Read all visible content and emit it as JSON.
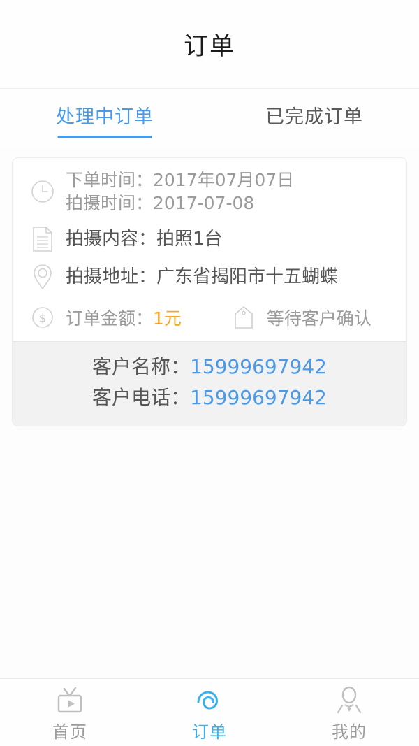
{
  "header": {
    "title": "订单"
  },
  "tabs": [
    {
      "label": "处理中订单",
      "active": true,
      "name": "tab-processing-orders"
    },
    {
      "label": "已完成订单",
      "active": false,
      "name": "tab-completed-orders"
    }
  ],
  "order": {
    "order_time_line": "下单时间：2017年07月07日",
    "shoot_time_line": "拍摄时间：2017-07-08",
    "content_line": "拍摄内容：拍照1台",
    "address_line": "拍摄地址：广东省揭阳市十五蝴蝶",
    "amount_label": "订单金额：",
    "amount_value": "1元",
    "status_text": "等待客户确认",
    "customer_name_label": "客户名称：",
    "customer_name_value": "15999697942",
    "customer_phone_label": "客户电话：",
    "customer_phone_value": "15999697942",
    "icons": {
      "time": "clock-icon",
      "content": "document-icon",
      "address": "location-pin-icon",
      "amount": "dollar-circle-icon",
      "status": "tag-icon"
    }
  },
  "bottom_nav": [
    {
      "label": "首页",
      "icon": "tv-play-icon",
      "active": false,
      "name": "nav-item-home"
    },
    {
      "label": "订单",
      "icon": "spiral-icon",
      "active": true,
      "name": "nav-item-orders"
    },
    {
      "label": "我的",
      "icon": "person-icon",
      "active": false,
      "name": "nav-item-profile"
    }
  ],
  "colors": {
    "accent_blue": "#4a9ae8",
    "nav_active_blue": "#39b0ef",
    "amount_orange": "#f5a623",
    "muted_gray": "#9b9b9b",
    "page_bg": "#fdfdfd",
    "customer_bg": "#f2f2f2"
  }
}
